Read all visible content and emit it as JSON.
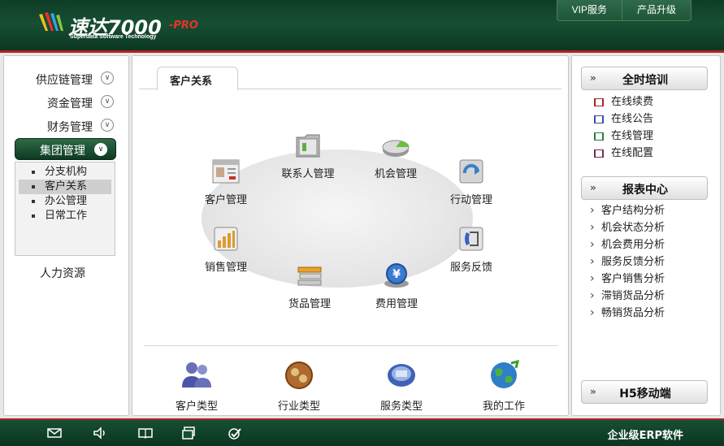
{
  "header": {
    "logo_title": "速达7000",
    "logo_suffix": "-PRO",
    "logo_subtitle": "Superdata Software Technology",
    "buttons": [
      "VIP服务",
      "产品升级"
    ]
  },
  "sidebar": {
    "menus": [
      "供应链管理",
      "资金管理",
      "财务管理"
    ],
    "active_menu": "集团管理",
    "submenu": [
      "分支机构",
      "客户关系",
      "办公管理",
      "日常工作"
    ],
    "selected_submenu": "客户关系",
    "extra": "人力资源"
  },
  "main": {
    "tab": "客户关系",
    "modules": [
      "联系人管理",
      "机会管理",
      "客户管理",
      "行动管理",
      "销售管理",
      "服务反馈",
      "货品管理",
      "费用管理"
    ],
    "bottom_modules": [
      "客户类型",
      "行业类型",
      "服务类型",
      "我的工作"
    ]
  },
  "right": {
    "training_title": "全时培训",
    "training_items": [
      "在线续费",
      "在线公告",
      "在线管理",
      "在线配置"
    ],
    "report_title": "报表中心",
    "report_items": [
      "客户结构分析",
      "机会状态分析",
      "机会费用分析",
      "服务反馈分析",
      "客户销售分析",
      "滞销货品分析",
      "畅销货品分析"
    ],
    "mobile_title": "H5移动端"
  },
  "footer": {
    "text": "企业级ERP软件",
    "icons": [
      "mail-icon",
      "speaker-icon",
      "book-icon",
      "window-icon",
      "check-icon"
    ]
  },
  "colors": {
    "header_green": "#0e3d26",
    "accent_red": "#b5221e",
    "logo_red": "#e8322b"
  }
}
